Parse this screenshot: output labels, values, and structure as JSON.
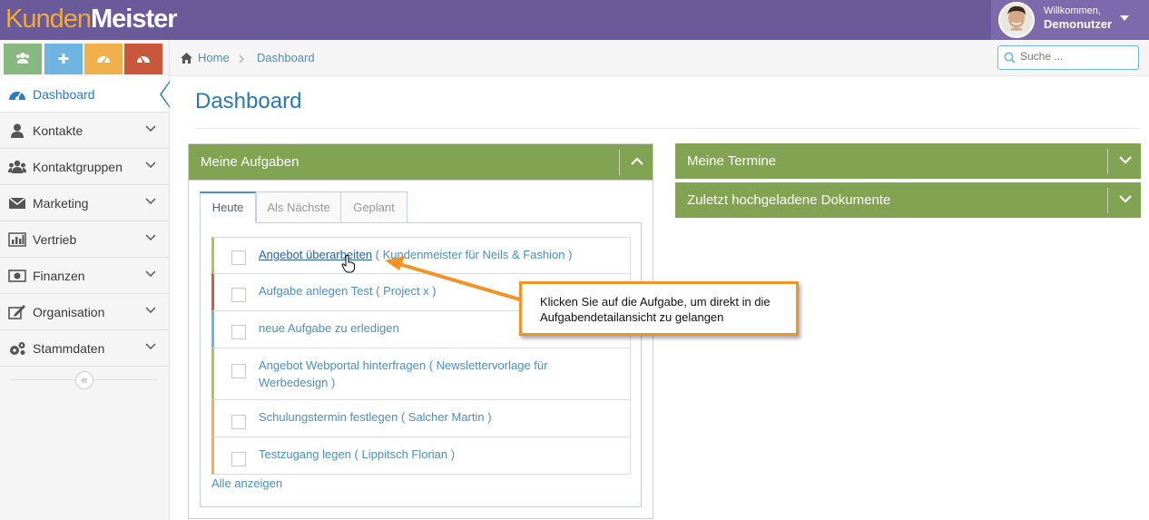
{
  "header": {
    "logo_part1": "Kunden",
    "logo_part2": "Meister",
    "welcome": "Willkommen,",
    "username": "Demonutzer"
  },
  "shortcuts": [
    {
      "icon": "users-icon",
      "color": "#87b87f"
    },
    {
      "icon": "plus-icon",
      "color": "#6fb3e0"
    },
    {
      "icon": "dashboard-icon",
      "color": "#f0b04c"
    },
    {
      "icon": "tachometer-icon",
      "color": "#c9573b"
    }
  ],
  "sidebar": {
    "items": [
      {
        "label": "Dashboard",
        "icon": "dashboard-icon",
        "active": true
      },
      {
        "label": "Kontakte",
        "icon": "user-icon"
      },
      {
        "label": "Kontaktgruppen",
        "icon": "users-icon"
      },
      {
        "label": "Marketing",
        "icon": "envelope-icon"
      },
      {
        "label": "Vertrieb",
        "icon": "bar-chart-icon"
      },
      {
        "label": "Finanzen",
        "icon": "money-icon"
      },
      {
        "label": "Organisation",
        "icon": "edit-icon"
      },
      {
        "label": "Stammdaten",
        "icon": "cogs-icon"
      }
    ],
    "collapse_glyph": "«"
  },
  "breadcrumb": {
    "home": "Home",
    "current": "Dashboard"
  },
  "search": {
    "placeholder": "Suche ..."
  },
  "page": {
    "title": "Dashboard"
  },
  "tasks_widget": {
    "title": "Meine Aufgaben",
    "tabs": [
      "Heute",
      "Als Nächste",
      "Geplant"
    ],
    "active_tab": "Heute",
    "items": [
      {
        "title": "Angebot überarbeiten",
        "context": "( Kundenmeister für Neils & Fashion )",
        "color": "#b2c153"
      },
      {
        "title": "Aufgabe anlegen Test",
        "context": "( Project x )",
        "color": "#d15b47"
      },
      {
        "title": "neue Aufgabe zu erledigen",
        "context": "",
        "color": "#6fb3e0"
      },
      {
        "title": "Angebot Webportal hinterfragen",
        "context": "( Newslettervorlage für",
        "context2": "Werbedesign )",
        "color": "#b2c153"
      },
      {
        "title": "Schulungstermin festlegen",
        "context": "( Salcher Martin )",
        "color": "#f0b04c"
      },
      {
        "title": "Testzugang legen",
        "context": "( Lippitsch Florian )",
        "color": "#f0b04c"
      }
    ],
    "show_all": "Alle anzeigen"
  },
  "appointments_widget": {
    "title": "Meine Termine"
  },
  "documents_widget": {
    "title": "Zuletzt hochgeladene Dokumente"
  },
  "callout": {
    "text": "Klicken Sie auf die Aufgabe, um direkt in die Aufgabendetailansicht zu gelangen"
  },
  "colors": {
    "header": "#6b5a9a",
    "widget_header": "#82a352",
    "link": "#4c8fbd",
    "callout_border": "#f29325"
  }
}
